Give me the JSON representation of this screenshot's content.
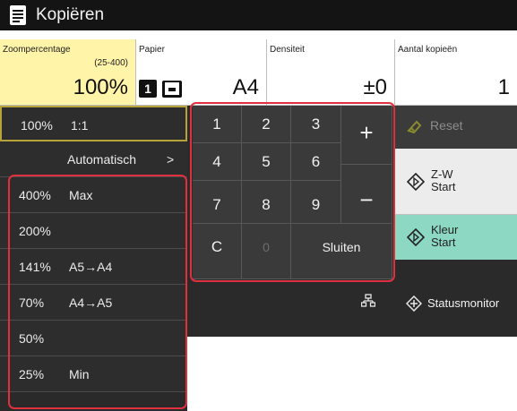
{
  "title_bar": {
    "title": "Kopiëren",
    "icon": "copy-document-icon"
  },
  "settings": {
    "zoom": {
      "label": "Zoompercentage",
      "range": "(25-400)",
      "value": "100%"
    },
    "paper": {
      "label": "Papier",
      "tray": "1",
      "value": "A4",
      "tray_icon": "paper-tray-icon"
    },
    "density": {
      "label": "Densiteit",
      "value": "±0"
    },
    "copies": {
      "label": "Aantal kopieën",
      "value": "1"
    }
  },
  "zoom_list": {
    "preset_100": {
      "percent": "100%",
      "name": "1:1"
    },
    "auto": {
      "label": "Automatisch",
      "chevron": ">"
    },
    "items": [
      {
        "percent": "400%",
        "name": "Max"
      },
      {
        "percent": "200%",
        "name": ""
      },
      {
        "percent": "141%",
        "name": "A5→A4"
      },
      {
        "percent": "70%",
        "name": "A4→A5"
      },
      {
        "percent": "50%",
        "name": ""
      },
      {
        "percent": "25%",
        "name": "Min"
      }
    ]
  },
  "keypad": {
    "keys": [
      "1",
      "2",
      "3",
      "4",
      "5",
      "6",
      "7",
      "8",
      "9",
      "C",
      "0"
    ],
    "plus": "+",
    "minus": "−",
    "close": "Sluiten"
  },
  "actions": {
    "reset": "Reset",
    "bw_start": [
      "Z-W",
      "Start"
    ],
    "color_start": [
      "Kleur",
      "Start"
    ],
    "status_monitor": "Statusmonitor"
  },
  "colors": {
    "title_bar": "#141414",
    "zoom_highlight": "#fff4a8",
    "panel_dark": "#2a2a2a",
    "keypad_key": "#3a3a3a",
    "color_start": "#8dd8c2",
    "bw_start": "#ececec",
    "annotation_frame": "#e0303f",
    "selected_border": "#b8a23a"
  }
}
